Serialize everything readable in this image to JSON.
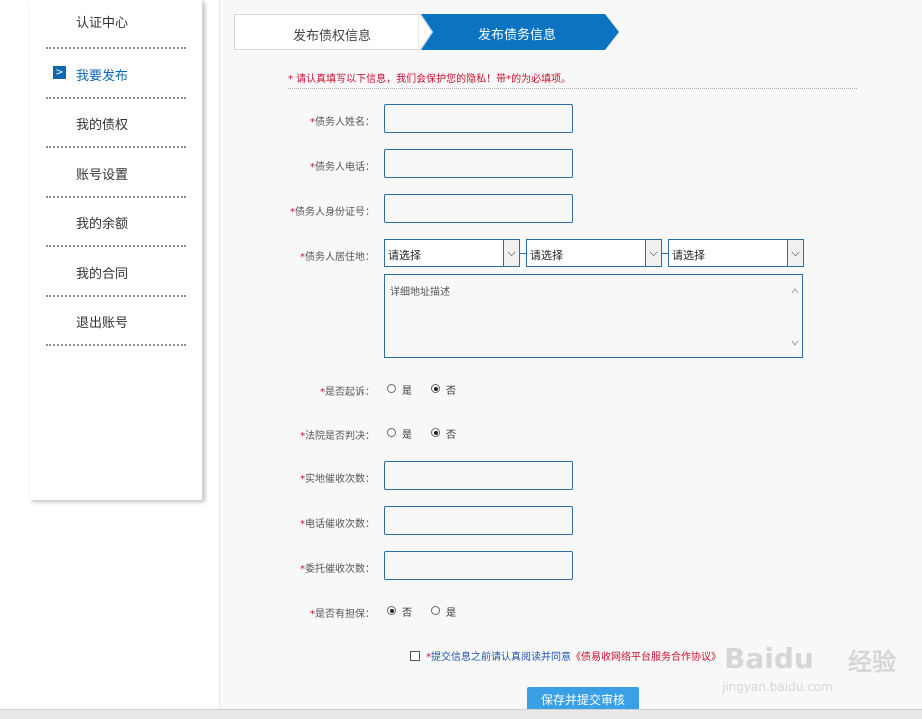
{
  "sidebar": {
    "items": [
      {
        "label": "认证中心",
        "active": false
      },
      {
        "label": "我要发布",
        "active": true,
        "marker": ">"
      },
      {
        "label": "我的债权",
        "active": false
      },
      {
        "label": "账号设置",
        "active": false
      },
      {
        "label": "我的余额",
        "active": false
      },
      {
        "label": "我的合同",
        "active": false
      },
      {
        "label": "退出账号",
        "active": false
      }
    ]
  },
  "tabs": [
    {
      "label": "发布债权信息",
      "active": false
    },
    {
      "label": "发布债务信息",
      "active": true
    }
  ],
  "notice": "* 请认真填写以下信息，我们会保护您的隐私！带*的为必填项。",
  "form": {
    "required_mark": "*",
    "debtor_name_label": "债务人姓名：",
    "debtor_phone_label": "债务人电话：",
    "debtor_id_label": "债务人身份证号：",
    "debtor_address_label": "债务人居住地：",
    "address_selects": [
      "请选择",
      "请选择",
      "请选择"
    ],
    "address_detail_placeholder": "详细地址描述",
    "sued_label": "是否起诉：",
    "sued_options": [
      "是",
      "否"
    ],
    "sued_selected": "否",
    "judged_label": "法院是否判决：",
    "judged_options": [
      "是",
      "否"
    ],
    "judged_selected": "否",
    "onsite_count_label": "实地催收次数：",
    "phone_count_label": "电话催收次数：",
    "entrust_count_label": "委托催收次数：",
    "guarantee_label": "是否有担保：",
    "guarantee_options": [
      "否",
      "是"
    ],
    "guarantee_selected": "否"
  },
  "agreement": {
    "star": "*",
    "text": "提交信息之前请认真阅读并同意",
    "link": "《债易收网络平台服务合作协议》"
  },
  "submit_label": "保存并提交审核",
  "watermark": {
    "brand": "Baidu",
    "cn": "经验",
    "url": "jingyan.baidu.com"
  },
  "colors": {
    "accent": "#0a68b5",
    "required": "#c8102e",
    "button": "#3aa0e6"
  }
}
